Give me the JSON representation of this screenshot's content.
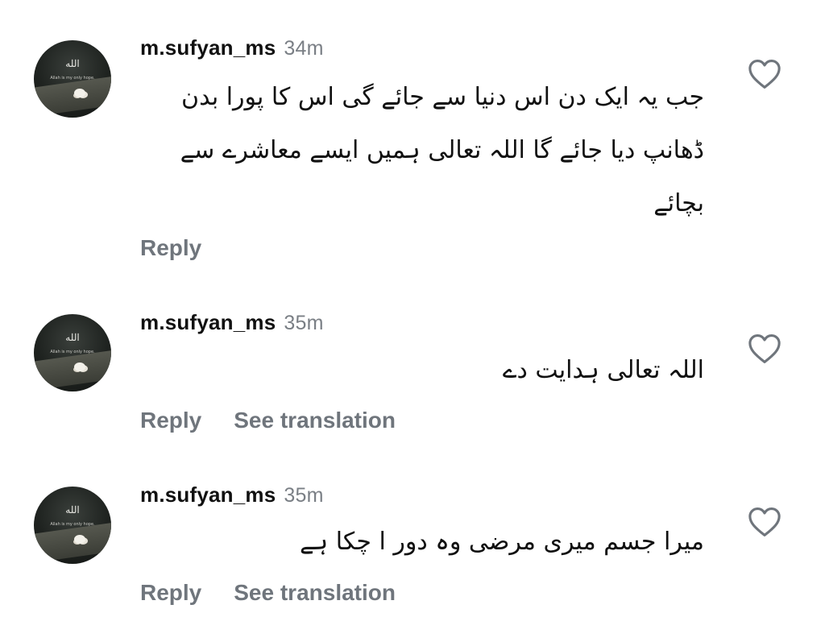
{
  "comments": [
    {
      "username": "m.sufyan_ms",
      "time": "34m",
      "text": "جب یہ ایک دن اس دنیا سے جائے گی اس کا پورا بدن ڈھانپ دیا جائے گا اللہ تعالی ہمیں ایسے معاشرے سے بچائے",
      "reply_label": "Reply",
      "translation_label": ""
    },
    {
      "username": "m.sufyan_ms",
      "time": "35m",
      "text": "اللہ تعالی ہدایت دے",
      "reply_label": "Reply",
      "translation_label": "See translation"
    },
    {
      "username": "m.sufyan_ms",
      "time": "35m",
      "text": "میرا جسم میری مرضی وہ دور ا چکا ہے",
      "reply_label": "Reply",
      "translation_label": "See translation"
    }
  ],
  "avatar": {
    "calligraphy": "الله",
    "tagline": "Allah is my only hope."
  },
  "icons": {
    "like": "heart-outline-icon"
  },
  "colors": {
    "text": "#111111",
    "muted": "#6f757c",
    "timestamp": "#7a7f85",
    "background": "#ffffff"
  }
}
